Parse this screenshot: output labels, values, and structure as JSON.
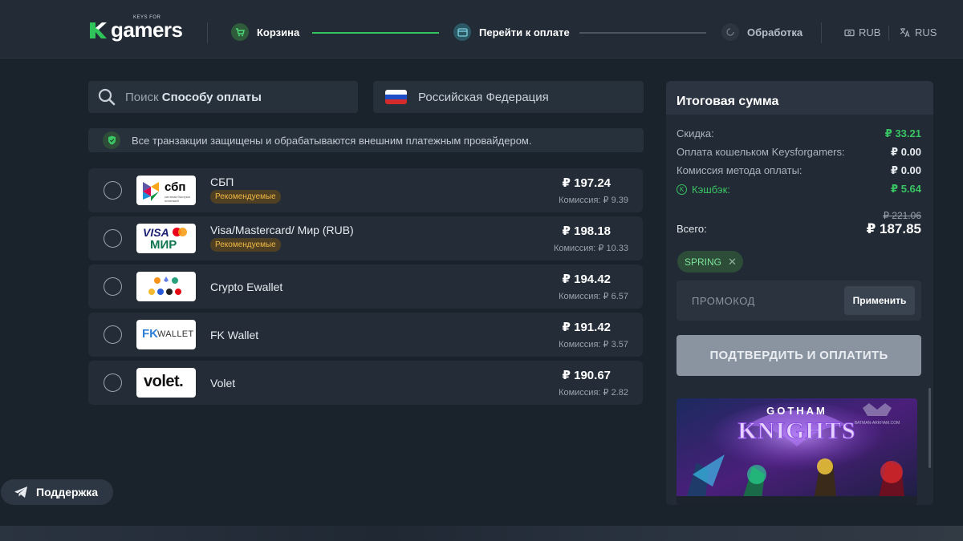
{
  "header": {
    "logo_small": "KEYS FOR",
    "logo_big": "gamers",
    "steps": [
      {
        "label": "Корзина",
        "state": "done"
      },
      {
        "label": "Перейти к оплате",
        "state": "active"
      },
      {
        "label": "Обработка",
        "state": "pending"
      }
    ],
    "currency": "RUB",
    "language": "RUS"
  },
  "search": {
    "placeholder_prefix": "Поиск",
    "placeholder_bold": "Способу оплаты"
  },
  "country": {
    "label": "Российская Федерация"
  },
  "notice": {
    "text": "Все транзакции защищены и обрабатываются внешним платежным провайдером."
  },
  "payments": [
    {
      "name": "СБП",
      "badge": "Рекомендуемые",
      "price": "₽ 197.24",
      "fee": "Комиссия: ₽ 9.39",
      "logo": "sbp-logo"
    },
    {
      "name": "Visa/Mastercard/ Мир (RUB)",
      "badge": "Рекомендуемые",
      "price": "₽ 198.18",
      "fee": "Комиссия: ₽ 10.33",
      "logo": "visa-mir-logo"
    },
    {
      "name": "Crypto Ewallet",
      "badge": "",
      "price": "₽ 194.42",
      "fee": "Комиссия: ₽ 6.57",
      "logo": "crypto-logo"
    },
    {
      "name": "FK Wallet",
      "badge": "",
      "price": "₽ 191.42",
      "fee": "Комиссия: ₽ 3.57",
      "logo": "fk-wallet-logo"
    },
    {
      "name": "Volet",
      "badge": "",
      "price": "₽ 190.67",
      "fee": "Комиссия: ₽ 2.82",
      "logo": "volet-logo"
    }
  ],
  "logos": {
    "sbp_text": "сбп",
    "sbp_small": "система быстрых платежей",
    "visa": "VISA",
    "mir": "МИР",
    "fk": "FK",
    "wallet": "WALLET",
    "volet": "volet."
  },
  "summary": {
    "title": "Итоговая сумма",
    "rows": [
      {
        "label": "Скидка:",
        "value": "₽ 33.21"
      },
      {
        "label": "Оплата кошельком Keysforgamers:",
        "value": "₽ 0.00"
      },
      {
        "label": "Комиссия метода оплаты:",
        "value": "₽ 0.00"
      },
      {
        "label": "Кэшбэк:",
        "value": "₽ 5.64"
      }
    ],
    "total_label": "Всего:",
    "old_price": "₽ 221.06",
    "total": "₽ 187.85",
    "promo_code": "SPRING",
    "promo_placeholder": "ПРОМОКОД",
    "apply": "Применить",
    "confirm": "ПОДТВЕРДИТЬ И ОПЛАТИТЬ",
    "banner_title_top": "GOTHAM",
    "banner_title_bottom": "KNIGHTS",
    "banner_watermark": "BATMAN-ARKHAM.COM"
  },
  "support": {
    "label": "Поддержка"
  },
  "colors": {
    "accent_green": "#39c463",
    "background": "#1a222c",
    "panel": "#232c37",
    "badge_text": "#f0b844"
  }
}
